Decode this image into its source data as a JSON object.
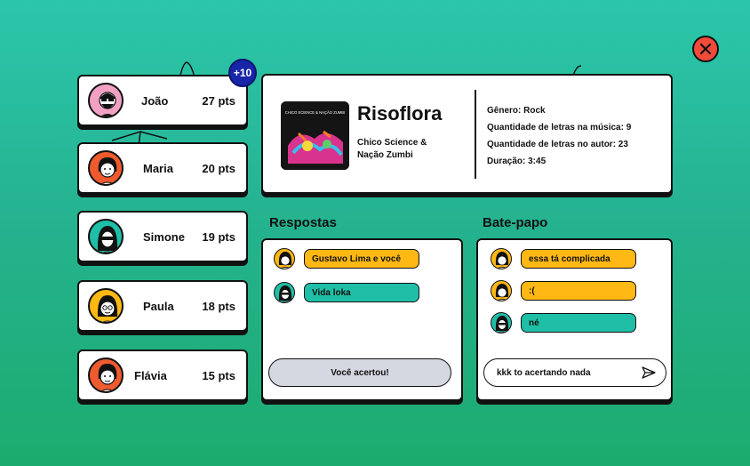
{
  "players": [
    {
      "name": "João",
      "points": "27 pts",
      "bonus": "+10"
    },
    {
      "name": "Maria",
      "points": "20 pts"
    },
    {
      "name": "Simone",
      "points": "19 pts"
    },
    {
      "name": "Paula",
      "points": "18 pts"
    },
    {
      "name": "Flávia",
      "points": "15 pts"
    }
  ],
  "song": {
    "title": "Risoflora",
    "artist": "Chico Science & Nação Zumbi",
    "cover_text": "CHICO SCIENCE & NAÇÃO ZUMBI",
    "genre": "Gênero: Rock",
    "letters_song": "Quantidade de letras na música: 9",
    "letters_artist": "Quantidade de letras no autor: 23",
    "duration": "Duração: 3:45"
  },
  "answers": {
    "title": "Respostas",
    "items": [
      {
        "text": "Gustavo Lima e você",
        "color": "#ffb814"
      },
      {
        "text": "Vida loka",
        "color": "#1fbfa7"
      }
    ],
    "result": "Você acertou!"
  },
  "chat": {
    "title": "Bate-papo",
    "messages": [
      {
        "text": "essa tá complicada",
        "color": "#ffb814"
      },
      {
        "text": ":(",
        "color": "#ffb814"
      },
      {
        "text": "né",
        "color": "#1fbfa7"
      }
    ],
    "input_value": "kkk to acertando nada"
  },
  "icons": {
    "close": "close-x-icon",
    "send": "send-icon"
  }
}
